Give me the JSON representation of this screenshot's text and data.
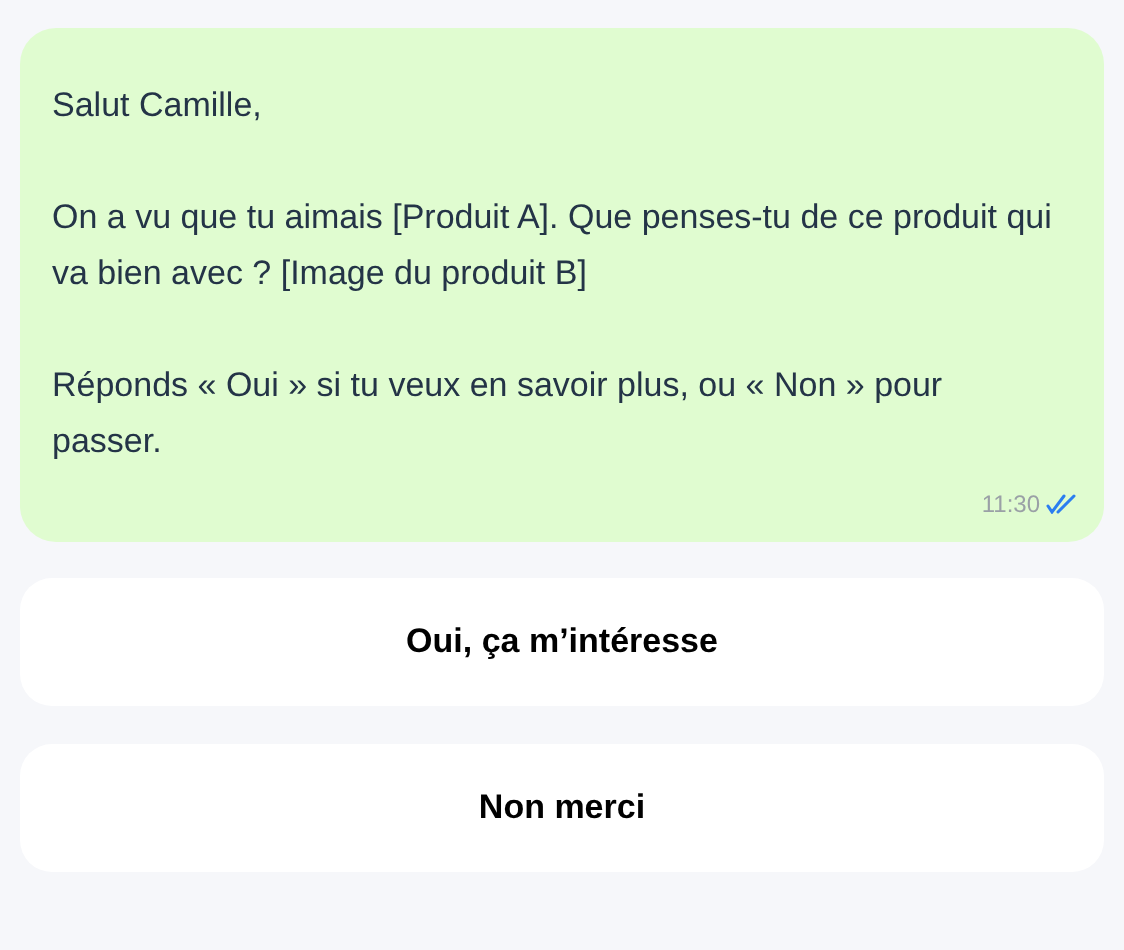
{
  "message": {
    "paragraphs": [
      "Salut Camille,",
      "On a vu que tu aimais [Produit A]. Que penses-tu de ce produit qui va bien avec ? [Image du produit B]",
      "Réponds « Oui » si tu veux en savoir plus, ou « Non » pour passer."
    ],
    "time": "11:30",
    "read": true
  },
  "buttons": [
    "Oui, ça m’intéresse",
    "Non merci"
  ]
}
